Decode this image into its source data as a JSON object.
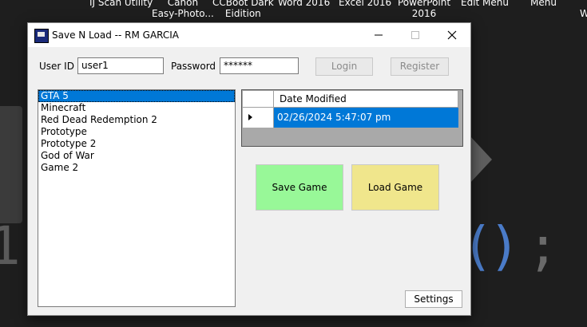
{
  "desktop": {
    "icons": [
      {
        "label": "IJ Scan Utility"
      },
      {
        "label": "Canon\nEasy-Photo..."
      },
      {
        "label": "CCBoot Dark\nEidition"
      },
      {
        "label": "Word 2016"
      },
      {
        "label": "Excel 2016"
      },
      {
        "label": "PowerPoint\n2016"
      },
      {
        "label": "Edit Menu"
      },
      {
        "label": "Menu"
      },
      {
        "label": "W"
      }
    ],
    "code_digit": "1",
    "code_parens": "()",
    "code_semicolon": ";"
  },
  "window": {
    "title": "Save N Load -- RM GARCIA",
    "minimize_icon": "minimize-icon",
    "maximize_icon": "maximize-icon",
    "close_icon": "close-icon"
  },
  "login": {
    "user_id_label": "User ID",
    "user_id_value": "user1",
    "password_label": "Password",
    "password_value": "******",
    "login_label": "Login",
    "register_label": "Register"
  },
  "games": {
    "items": [
      "GTA 5",
      "Minecraft",
      "Red Dead Redemption 2",
      "Prototype",
      "Prototype 2",
      "God of War",
      "Game 2"
    ],
    "selected_index": 0
  },
  "grid": {
    "column_header": "Date Modified",
    "rows": [
      {
        "date_modified": "02/26/2024 5:47:07 pm"
      }
    ]
  },
  "actions": {
    "save_label": "Save Game",
    "load_label": "Load Game",
    "settings_label": "Settings",
    "save_color": "#98f898",
    "load_color": "#f0e68c"
  }
}
